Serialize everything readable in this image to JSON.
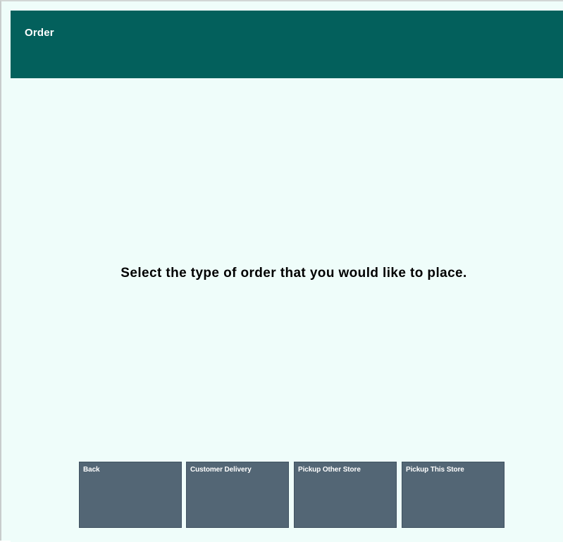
{
  "header": {
    "title": "Order"
  },
  "main": {
    "prompt": "Select the type of order that you would like to place."
  },
  "buttons": {
    "back": "Back",
    "customer_delivery": "Customer Delivery",
    "pickup_other_store": "Pickup Other Store",
    "pickup_this_store": "Pickup This Store"
  },
  "colors": {
    "header_bg": "#03605c",
    "content_bg": "#effdfa",
    "button_bg": "#536675",
    "header_text": "#ffffff",
    "button_text": "#ffffff"
  }
}
